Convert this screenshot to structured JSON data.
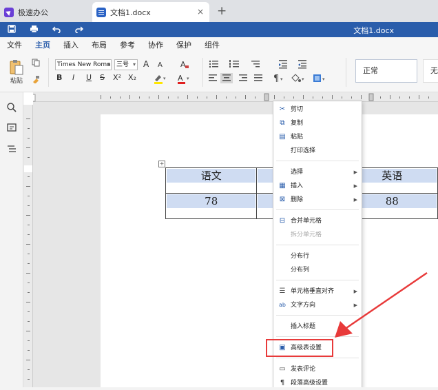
{
  "tabs": {
    "app_title": "极速办公",
    "doc_tab": "文档1.docx",
    "close": "×",
    "new_tab": "+"
  },
  "titlebar": {
    "doc_title": "文档1.docx"
  },
  "menu": [
    "文件",
    "主页",
    "插入",
    "布局",
    "参考",
    "协作",
    "保护",
    "组件"
  ],
  "ribbon": {
    "paste_label": "粘贴",
    "font_name": "Times New Roma",
    "font_size": "三号",
    "grow": "A",
    "shrink": "A",
    "bold": "B",
    "italic": "I",
    "underline": "U",
    "strike": "S",
    "superscript": "X²",
    "subscript": "X₂",
    "style_normal": "正常",
    "style_next": "无"
  },
  "table": {
    "row1": [
      "语文",
      "",
      "英语"
    ],
    "row2": [
      "78",
      "",
      "88"
    ]
  },
  "context_menu": {
    "cut": "剪切",
    "copy": "复制",
    "paste": "粘贴",
    "print_selection": "打印选择",
    "select": "选择",
    "insert": "插入",
    "delete": "删除",
    "merge_cells": "合并单元格",
    "split_cell": "拆分单元格",
    "distribute_rows": "分布行",
    "distribute_columns": "分布列",
    "cell_vertical_align": "单元格垂直对齐",
    "text_direction": "文字方向",
    "insert_caption": "插入标题",
    "advanced_table_settings": "高级表设置",
    "add_comment": "发表评论",
    "paragraph_advanced": "段落高级设置"
  },
  "colors": {
    "accent": "#2a5dab",
    "highlight_box": "#e83a3a",
    "cell_shading": "#cfdcf2"
  }
}
